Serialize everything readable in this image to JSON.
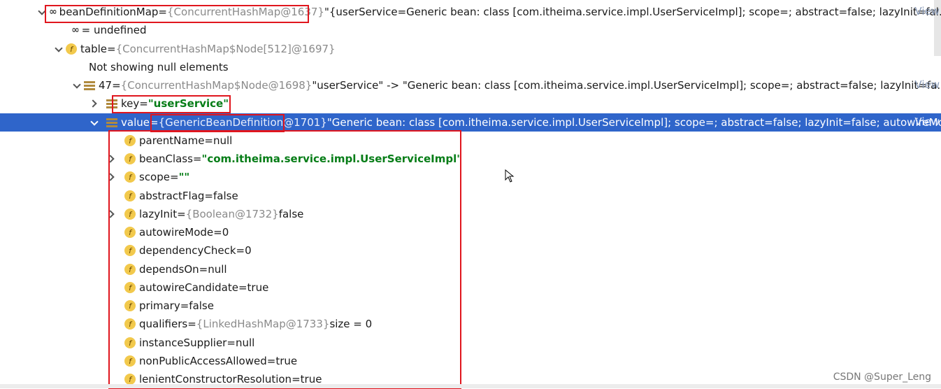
{
  "rows": [
    {
      "name": "beanDefinitionMap",
      "eq": " = ",
      "ref": "{ConcurrentHashMap@1637}",
      "rest": " \"{userService=Generic bean: class [com.itheima.service.impl.UserServiceImpl]; scope=; abstract=false; lazyInit=fal...",
      "view": "View"
    },
    {
      "name": "= undefined"
    },
    {
      "name": "table",
      "eq": " = ",
      "ref": "{ConcurrentHashMap$Node[512]@1697}"
    },
    {
      "name": "Not showing null elements"
    },
    {
      "name": "47",
      "eq": " = ",
      "ref": "{ConcurrentHashMap$Node@1698}",
      "rest": " \"userService\" -> \"Generic bean: class [com.itheima.service.impl.UserServiceImpl]; scope=; abstract=false; lazyInit=fa...",
      "view": "View"
    },
    {
      "name": "key",
      "eq": " = ",
      "val": "\"userService\""
    },
    {
      "name": "value",
      "eq": " = ",
      "ref": "{GenericBeanDefinition@1701}",
      "rest": " \"Generic bean: class [com.itheima.service.impl.UserServiceImpl]; scope=; abstract=false; lazyInit=false; autowireMo...",
      "view": "View"
    },
    {
      "name": "parentName",
      "eq": " = ",
      "val": "null"
    },
    {
      "name": "beanClass",
      "eq": " = ",
      "val": "\"com.itheima.service.impl.UserServiceImpl\""
    },
    {
      "name": "scope",
      "eq": " = ",
      "val": "\"\""
    },
    {
      "name": "abstractFlag",
      "eq": " = ",
      "val": "false"
    },
    {
      "name": "lazyInit",
      "eq": " = ",
      "ref": "{Boolean@1732}",
      "rest": " false"
    },
    {
      "name": "autowireMode",
      "eq": " = ",
      "val": "0"
    },
    {
      "name": "dependencyCheck",
      "eq": " = ",
      "val": "0"
    },
    {
      "name": "dependsOn",
      "eq": " = ",
      "val": "null"
    },
    {
      "name": "autowireCandidate",
      "eq": " = ",
      "val": "true"
    },
    {
      "name": "primary",
      "eq": " = ",
      "val": "false"
    },
    {
      "name": "qualifiers",
      "eq": " = ",
      "ref": "{LinkedHashMap@1733}",
      "rest": "  size = 0"
    },
    {
      "name": "instanceSupplier",
      "eq": " = ",
      "val": "null"
    },
    {
      "name": "nonPublicAccessAllowed",
      "eq": " = ",
      "val": "true"
    },
    {
      "name": "lenientConstructorResolution",
      "eq": " = ",
      "val": "true"
    }
  ],
  "watermark": "CSDN @Super_Leng",
  "colors": {
    "selection": "#2f65ca",
    "annotation": "#e0161e",
    "string": "#067d17",
    "field_icon": "#f2c94c"
  }
}
